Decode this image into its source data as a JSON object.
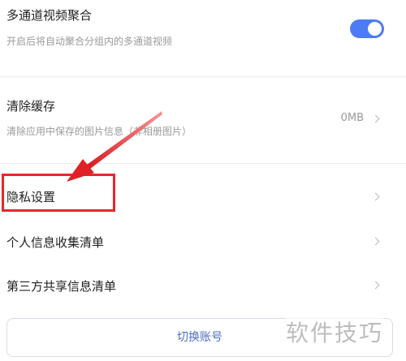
{
  "settings": {
    "multi_channel": {
      "title": "多通道视频聚合",
      "subtitle": "开启后将自动聚合分组内的多通道视频",
      "enabled": true
    },
    "clear_cache": {
      "title": "清除缓存",
      "subtitle": "清除应用中保存的图片信息（非相册图片）",
      "value": "0MB"
    },
    "privacy": {
      "title": "隐私设置"
    },
    "personal_info": {
      "title": "个人信息收集清单"
    },
    "third_party": {
      "title": "第三方共享信息清单"
    }
  },
  "switch_account": {
    "label": "切换账号"
  },
  "watermark": {
    "text": "软件技巧"
  },
  "colors": {
    "accent": "#4d7bf3",
    "highlight": "#e8262b"
  },
  "icons": {
    "chevron": "chevron-right-icon",
    "arrow": "arrow-icon"
  }
}
